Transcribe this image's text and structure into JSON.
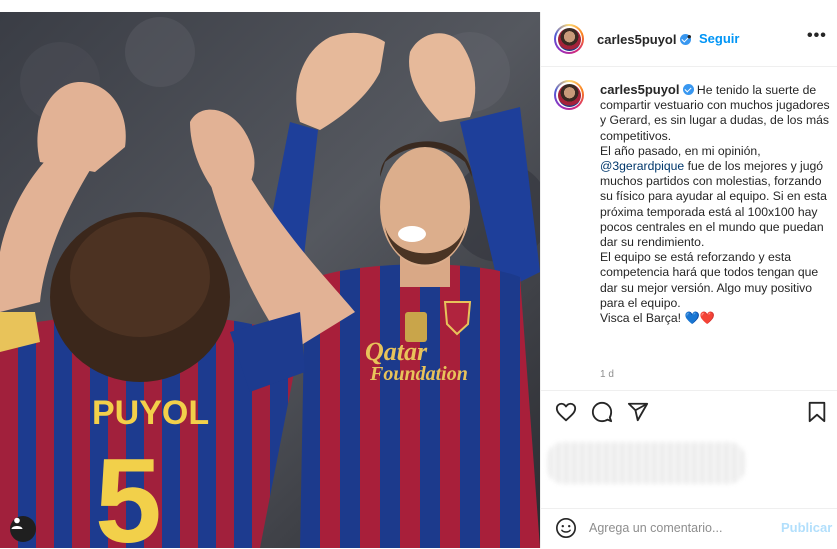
{
  "post": {
    "username": "carles5puyol",
    "follow_label": "Seguir",
    "separator": "•",
    "more_label": "•••",
    "caption": {
      "line1": "He tenido la suerte de compartir vestuario con muchos jugadores y Gerard, es sin lugar a dudas, de los más competitivos.",
      "line2_before": "El año pasado, en mi opinión,",
      "mention": "@3gerardpique",
      "line2_after": "fue de los mejores y jugó muchos partidos con molestias, forzando su físico para ayudar al equipo. Si en esta próxima temporada está al 100x100 hay pocos centrales en el mundo que puedan dar su rendimiento.",
      "line3": "El equipo se está reforzando y esta competencia hará que todos tengan que dar su mejor versión. Algo muy positivo para el equipo.",
      "line4": "Visca el Barça!",
      "emojis": "💙❤️"
    },
    "timestamp": "1 d"
  },
  "photo": {
    "jersey_name": "PUYOL",
    "jersey_number": "5",
    "sponsor_line1": "Qatar",
    "sponsor_line2": "Foundation"
  },
  "icons": [
    "heart-icon",
    "comment-icon",
    "share-icon",
    "bookmark-icon",
    "emoji-icon",
    "user-tag-icon",
    "verified-icon"
  ],
  "comment_box": {
    "placeholder": "Agrega un comentario...",
    "publish_label": "Publicar"
  },
  "colors": {
    "link_blue": "#0095f6",
    "publish_disabled": "#b2dffc",
    "mention": "#00376b"
  }
}
